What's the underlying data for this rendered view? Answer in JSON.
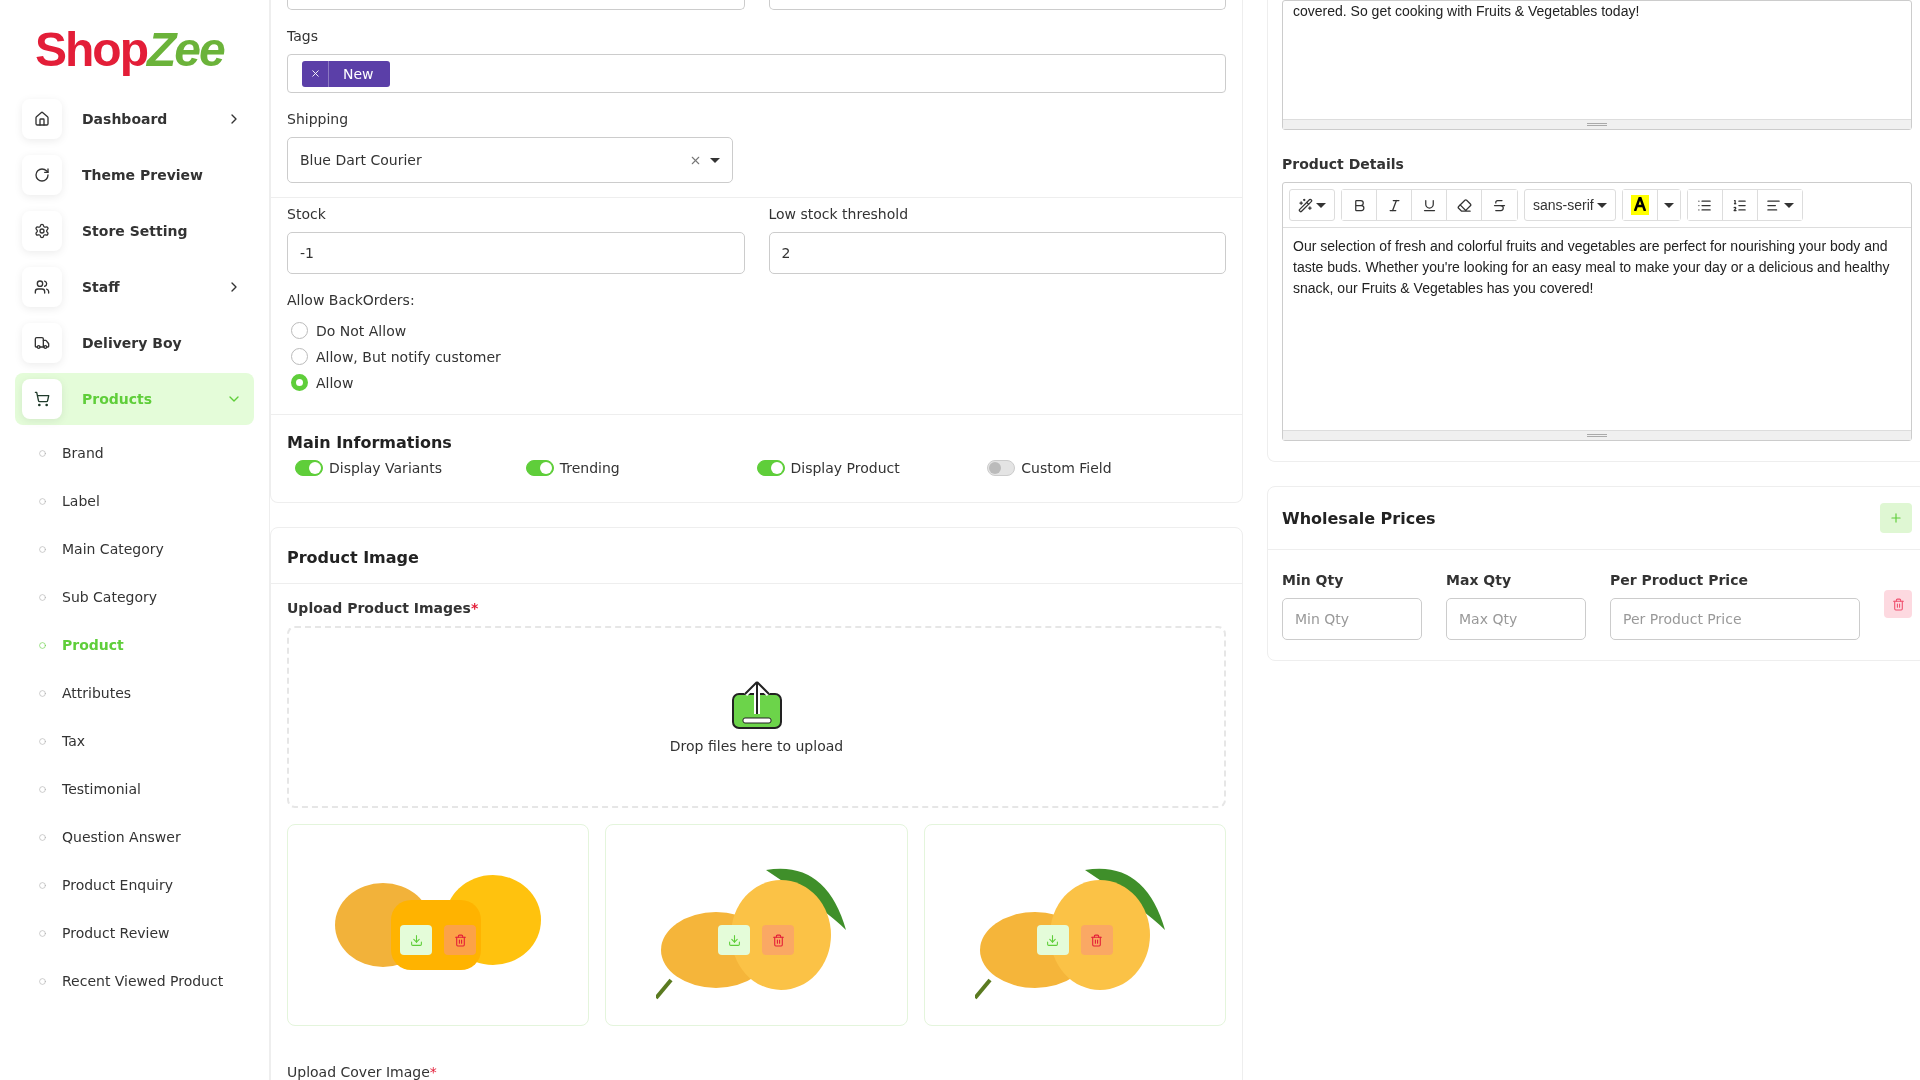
{
  "logo": {
    "first": "Shop",
    "second": "Zee"
  },
  "sidebar": {
    "items": [
      {
        "label": "Dashboard",
        "expanded": false,
        "selected": false
      },
      {
        "label": "Theme Preview",
        "selected": false
      },
      {
        "label": "Store Setting",
        "selected": false
      },
      {
        "label": "Staff",
        "expanded": false,
        "selected": false
      },
      {
        "label": "Delivery Boy",
        "selected": false
      },
      {
        "label": "Products",
        "expanded": true,
        "selected": true,
        "children": [
          {
            "label": "Brand",
            "selected": false
          },
          {
            "label": "Label",
            "selected": false
          },
          {
            "label": "Main Category",
            "selected": false
          },
          {
            "label": "Sub Category",
            "selected": false
          },
          {
            "label": "Product",
            "selected": true
          },
          {
            "label": "Attributes",
            "selected": false
          },
          {
            "label": "Tax",
            "selected": false
          },
          {
            "label": "Testimonial",
            "selected": false
          },
          {
            "label": "Question Answer",
            "selected": false
          },
          {
            "label": "Product Enquiry",
            "selected": false
          },
          {
            "label": "Product Review",
            "selected": false
          },
          {
            "label": "Recent Viewed Product",
            "selected": false
          }
        ]
      }
    ]
  },
  "general": {
    "tags": {
      "label": "Tags",
      "values": [
        "New"
      ]
    },
    "shipping": {
      "label": "Shipping",
      "value": "Blue Dart Courier"
    },
    "stock": {
      "label": "Stock",
      "value": "-1"
    },
    "low_stock": {
      "label": "Low stock threshold",
      "value": "2"
    },
    "backorders": {
      "label": "Allow BackOrders:",
      "options": [
        {
          "label": "Do Not Allow",
          "selected": false
        },
        {
          "label": "Allow, But notify customer",
          "selected": false
        },
        {
          "label": "Allow",
          "selected": true
        }
      ]
    }
  },
  "main_info": {
    "title": "Main Informations",
    "toggles": [
      {
        "label": "Display Variants",
        "on": true
      },
      {
        "label": "Trending",
        "on": true
      },
      {
        "label": "Display Product",
        "on": true
      },
      {
        "label": "Custom Field",
        "on": false
      }
    ]
  },
  "product_image": {
    "title": "Product Image",
    "upload_label": "Upload Product Images",
    "required": "*",
    "drop_text": "Drop files here to upload",
    "images": [
      {
        "kind": "cut"
      },
      {
        "kind": "whole"
      },
      {
        "kind": "whole"
      }
    ],
    "cover_label": "Upload Cover Image",
    "cover_required": "*"
  },
  "description": {
    "text": "covered. So get cooking with Fruits & Vegetables today!"
  },
  "product_details": {
    "label": "Product Details",
    "font": "sans-serif",
    "text": "Our selection of fresh and colorful fruits and vegetables are perfect for nourishing your body and taste buds. Whether you're looking for an easy meal to make your day or a delicious and healthy snack, our Fruits & Vegetables has you covered!"
  },
  "wholesale": {
    "title": "Wholesale Prices",
    "columns": [
      {
        "label": "Min Qty",
        "placeholder": "Min Qty"
      },
      {
        "label": "Max Qty",
        "placeholder": "Max Qty"
      },
      {
        "label": "Per Product Price",
        "placeholder": "Per Product Price"
      }
    ]
  }
}
